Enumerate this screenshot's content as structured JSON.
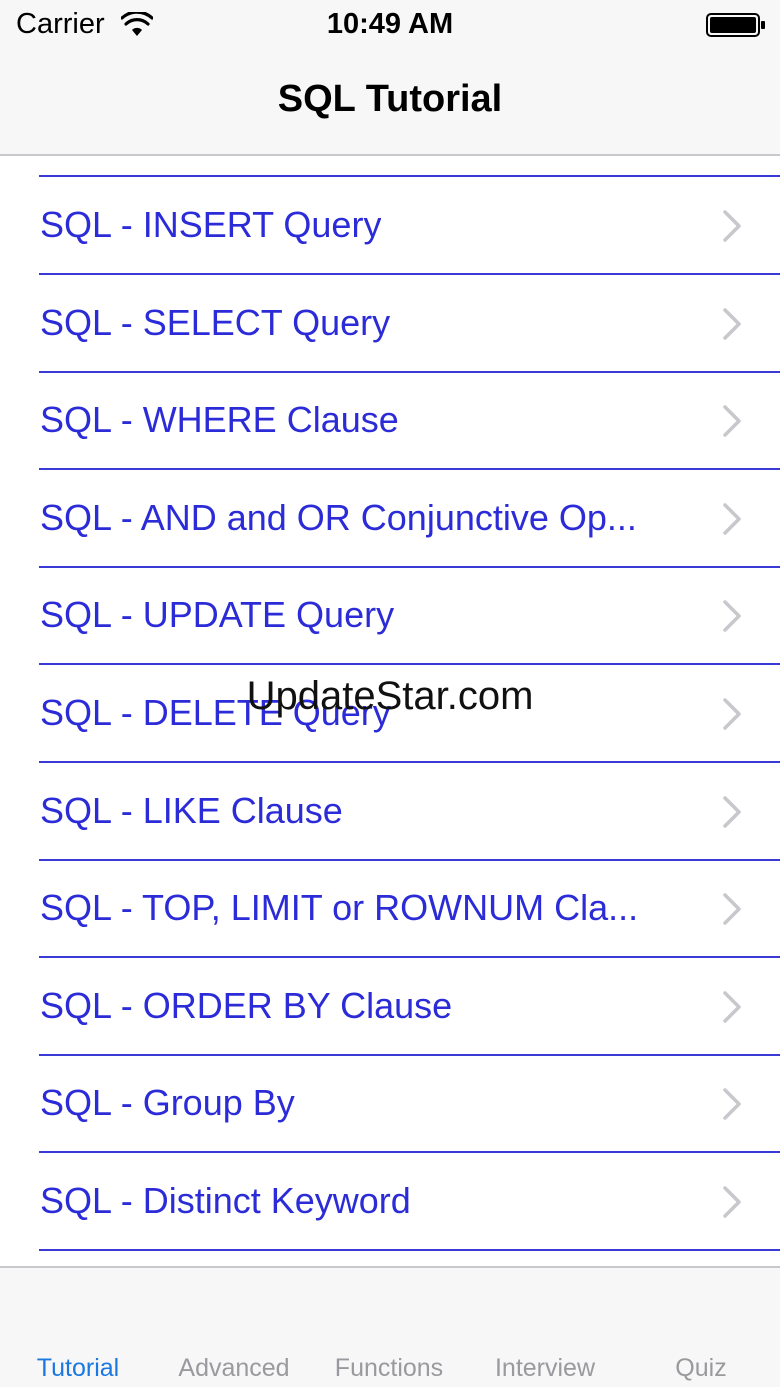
{
  "status_bar": {
    "carrier": "Carrier",
    "time": "10:49 AM",
    "wifi_icon": "wifi-icon",
    "battery_icon": "battery-icon"
  },
  "nav": {
    "title": "SQL Tutorial"
  },
  "list": {
    "items": [
      {
        "label": "SQL - INSERT Query"
      },
      {
        "label": "SQL - SELECT Query"
      },
      {
        "label": "SQL - WHERE Clause"
      },
      {
        "label": "SQL - AND and OR Conjunctive Op..."
      },
      {
        "label": "SQL - UPDATE Query"
      },
      {
        "label": "SQL - DELETE Query"
      },
      {
        "label": "SQL - LIKE Clause"
      },
      {
        "label": "SQL - TOP, LIMIT or ROWNUM Cla..."
      },
      {
        "label": "SQL - ORDER BY Clause"
      },
      {
        "label": "SQL - Group By"
      },
      {
        "label": "SQL - Distinct Keyword"
      }
    ],
    "chevron_icon": "chevron-right-icon"
  },
  "watermark": "UpdateStar.com",
  "tabs": [
    {
      "label": "Tutorial",
      "active": true
    },
    {
      "label": "Advanced",
      "active": false
    },
    {
      "label": "Functions",
      "active": false
    },
    {
      "label": "Interview",
      "active": false
    },
    {
      "label": "Quiz",
      "active": false
    }
  ],
  "colors": {
    "link_blue": "#2b2bd8",
    "separator": "#3a3ad6",
    "tab_active": "#1a78e0",
    "tab_inactive": "#9a9a9e"
  }
}
